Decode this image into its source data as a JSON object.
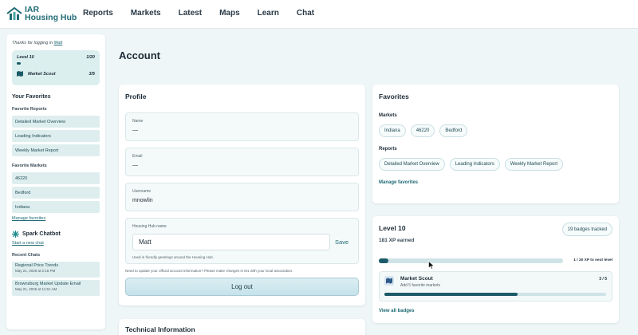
{
  "brand": {
    "line1": "IAR",
    "line2": "Housing Hub",
    "color": "#1f6b75"
  },
  "nav": [
    "Reports",
    "Markets",
    "Latest",
    "Maps",
    "Learn",
    "Chat"
  ],
  "sidebar": {
    "thanks_prefix": "Thanks for logging in",
    "user": "Matt",
    "level": {
      "label": "Level 10",
      "count": "1/20",
      "progress": 0.05
    },
    "scout": {
      "label": "Market Scout",
      "count": "3/5"
    },
    "favorites_heading": "Your Favorites",
    "fav_reports_heading": "Favorite Reports",
    "fav_reports": [
      "Detailed Market Overview",
      "Leading Indicators",
      "Weekly Market Report"
    ],
    "fav_markets_heading": "Favorite Markets",
    "fav_markets": [
      "46220",
      "Bedford",
      "Indiana"
    ],
    "manage": "Manage favorites",
    "chatbot_heading": "Spark Chatbot",
    "new_chat": "Start a new chat",
    "recent_heading": "Recent Chats",
    "recent": [
      {
        "title": "Regional Price Trends",
        "date": "May 21, 2026 at 2:15 PM"
      },
      {
        "title": "Brownsburg Market Update Email",
        "date": "May 21, 2026 at 11:51 AM"
      }
    ]
  },
  "page_title": "Account",
  "profile": {
    "heading": "Profile",
    "name": {
      "label": "Name",
      "value": "—"
    },
    "email": {
      "label": "Email",
      "value": "—"
    },
    "username": {
      "label": "Username",
      "value": "mnowlin"
    },
    "hh": {
      "label": "Housing Hub name",
      "value": "Matt",
      "save": "Save",
      "note": "Used in friendly greetings around the Housing Hub."
    },
    "update_note": "Need to update your official account information? Please make changes in M1 with your local association.",
    "logout": "Log out"
  },
  "tech": {
    "heading": "Technical Information"
  },
  "favorites": {
    "heading": "Favorites",
    "markets_heading": "Markets",
    "markets": [
      "Indiana",
      "46220",
      "Bedford"
    ],
    "reports_heading": "Reports",
    "reports": [
      "Detailed Market Overview",
      "Leading Indicators",
      "Weekly Market Report"
    ],
    "manage": "Manage favorites"
  },
  "level_card": {
    "title": "Level 10",
    "xp": "181 XP earned",
    "badges": "19 badges tracked",
    "progress": 0.05,
    "next": "1 / 20 XP to next level",
    "badge": {
      "title": "Market Scout",
      "desc": "Add 5 favorite markets",
      "count": "3 / 5",
      "progress": 0.6
    },
    "view_all": "View all badges"
  }
}
